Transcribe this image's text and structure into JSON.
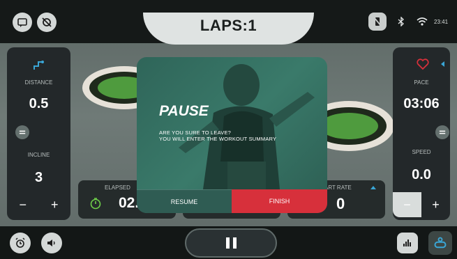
{
  "header": {
    "laps_label": "LAPS:1",
    "time": "23:41"
  },
  "icons_top_left": [
    "chat-icon",
    "no-sound-icon"
  ],
  "icons_top_right": [
    "phone-muted-icon",
    "bluetooth-icon",
    "wifi-icon"
  ],
  "left_panel": {
    "distance_label": "DISTANCE",
    "distance_value": "0.5",
    "incline_label": "INCLINE",
    "incline_value": "3",
    "minus": "−",
    "plus": "+"
  },
  "right_panel": {
    "pace_label": "PACE",
    "pace_value": "03:06",
    "speed_label": "SPEED",
    "speed_value": "0.0",
    "minus": "−",
    "plus": "+"
  },
  "stats": {
    "elapsed_label": "ELAPSED",
    "elapsed_value": "02.",
    "heart_rate_label": "ART RATE",
    "heart_rate_value": "0"
  },
  "modal": {
    "title": "PAUSE",
    "message_line1": "ARE YOU SURE TO LEAVE?",
    "message_line2": "YOU WILL ENTER THE WORKOUT SUMMARY",
    "resume_label": "RESUME",
    "finish_label": "FINISH"
  },
  "colors": {
    "finish": "#d7303b",
    "modal": "#3a7a6a",
    "accent": "#3aa6d6"
  }
}
